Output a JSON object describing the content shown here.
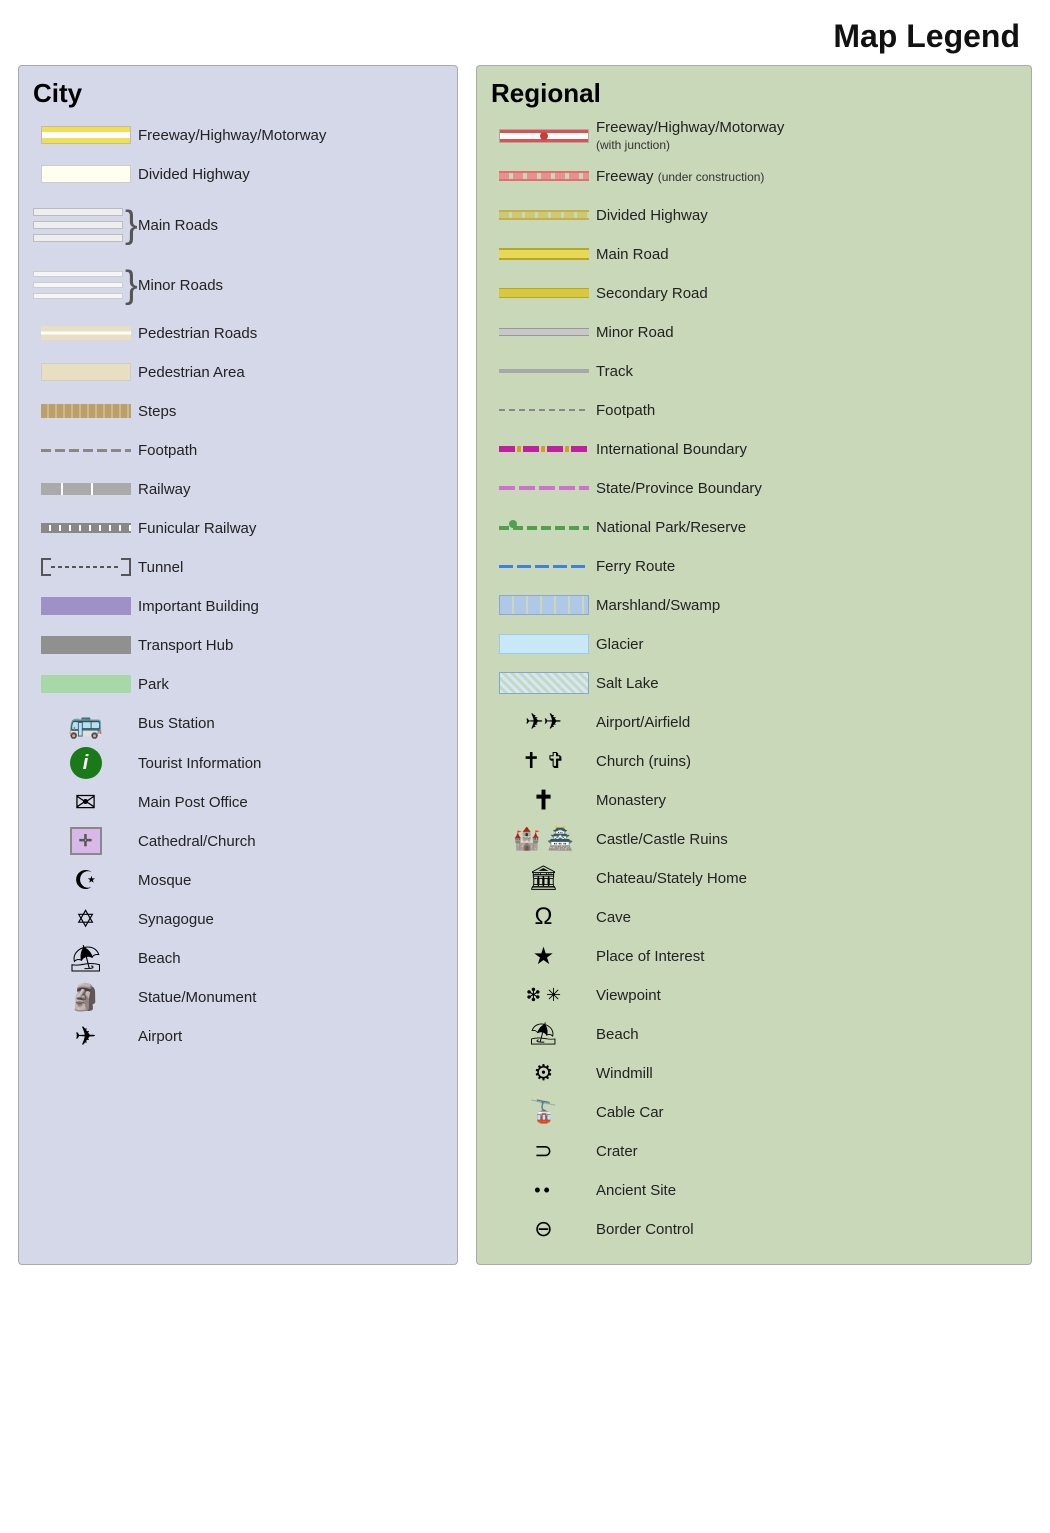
{
  "page": {
    "title": "Map Legend"
  },
  "city": {
    "title": "City",
    "items": [
      {
        "label": "Freeway/Highway/Motorway"
      },
      {
        "label": "Divided Highway"
      },
      {
        "label": "Main Roads"
      },
      {
        "label": "Minor Roads"
      },
      {
        "label": "Pedestrian Roads"
      },
      {
        "label": "Pedestrian Area"
      },
      {
        "label": "Steps"
      },
      {
        "label": "Footpath"
      },
      {
        "label": "Railway"
      },
      {
        "label": "Funicular Railway"
      },
      {
        "label": "Tunnel"
      },
      {
        "label": "Important Building"
      },
      {
        "label": "Transport Hub"
      },
      {
        "label": "Park"
      },
      {
        "label": "Bus Station"
      },
      {
        "label": "Tourist Information"
      },
      {
        "label": "Main Post Office"
      },
      {
        "label": "Cathedral/Church"
      },
      {
        "label": "Mosque"
      },
      {
        "label": "Synagogue"
      },
      {
        "label": "Beach"
      },
      {
        "label": "Statue/Monument"
      },
      {
        "label": "Airport"
      }
    ]
  },
  "regional": {
    "title": "Regional",
    "items": [
      {
        "label": "Freeway/Highway/Motorway",
        "sublabel": "(with junction)"
      },
      {
        "label": "Freeway",
        "sublabel": "(under construction)"
      },
      {
        "label": "Divided Highway"
      },
      {
        "label": "Main Road"
      },
      {
        "label": "Secondary Road"
      },
      {
        "label": "Minor Road"
      },
      {
        "label": "Track"
      },
      {
        "label": "Footpath"
      },
      {
        "label": "International Boundary"
      },
      {
        "label": "State/Province Boundary"
      },
      {
        "label": "National Park/Reserve"
      },
      {
        "label": "Ferry Route"
      },
      {
        "label": "Marshland/Swamp"
      },
      {
        "label": "Glacier"
      },
      {
        "label": "Salt Lake"
      },
      {
        "label": "Airport/Airfield"
      },
      {
        "label": "Church (ruins)"
      },
      {
        "label": "Monastery"
      },
      {
        "label": "Castle/Castle Ruins"
      },
      {
        "label": "Chateau/Stately Home"
      },
      {
        "label": "Cave"
      },
      {
        "label": "Place of Interest"
      },
      {
        "label": "Viewpoint"
      },
      {
        "label": "Beach"
      },
      {
        "label": "Windmill"
      },
      {
        "label": "Cable Car"
      },
      {
        "label": "Crater"
      },
      {
        "label": "Ancient Site"
      },
      {
        "label": "Border Control"
      }
    ]
  }
}
